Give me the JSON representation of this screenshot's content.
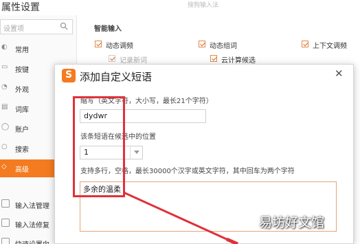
{
  "window": {
    "title": "属性设置",
    "faded_top_text": "搜狗输入法"
  },
  "sidebar": {
    "search_placeholder": "设置项",
    "items": [
      {
        "label": "常用",
        "icon": "gear-icon"
      },
      {
        "label": "按键",
        "icon": "keyboard-icon"
      },
      {
        "label": "外观",
        "icon": "palette-icon"
      },
      {
        "label": "词库",
        "icon": "book-icon"
      },
      {
        "label": "账户",
        "icon": "user-icon"
      },
      {
        "label": "搜索",
        "icon": "search-icon"
      },
      {
        "label": "高级",
        "icon": "advanced-icon",
        "active": true
      }
    ],
    "tools": [
      {
        "label": "输入法管理"
      },
      {
        "label": "输入法修复"
      },
      {
        "label": "快速设置向"
      }
    ]
  },
  "smart_input": {
    "section_title": "智能输入",
    "options": [
      {
        "label": "动态调频",
        "checked": true
      },
      {
        "label": "动态组词",
        "checked": true
      },
      {
        "label": "上下文调频",
        "checked": true
      },
      {
        "label": "记录新词",
        "checked": true
      },
      {
        "label": "云计算候选",
        "checked": true
      }
    ]
  },
  "dialog": {
    "title": "添加自定义短语",
    "logo_letter": "S",
    "abbr_label": "缩写（英文字符，大小写，最长21个字符）",
    "abbr_value": "dydwr",
    "position_label": "该条短语在候选中的位置",
    "position_value": "1",
    "content_label": "支持多行，空格，最长30000个汉字或英文字符，其中回车为两个字符",
    "content_value": "多余的温柔"
  },
  "watermark": "易坊好文馆",
  "colors": {
    "accent": "#f47b20",
    "highlight": "#e0303a"
  }
}
